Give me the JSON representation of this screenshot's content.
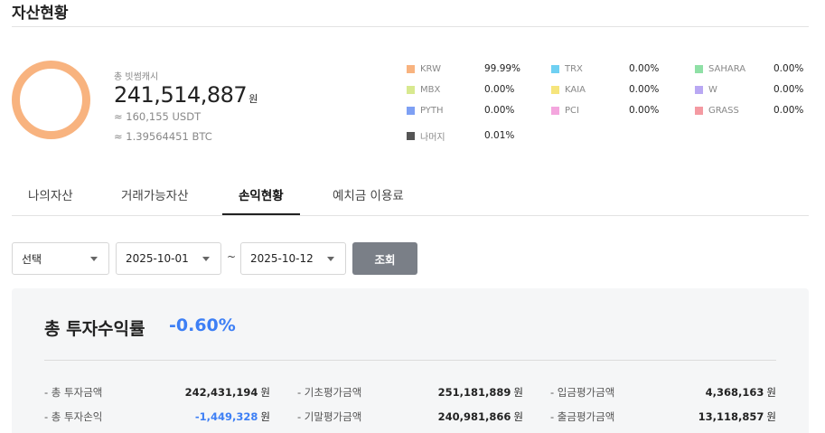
{
  "page": {
    "title": "자산현황"
  },
  "summary": {
    "label": "총 빗썸캐시",
    "total": "241,514,887",
    "total_unit": "원",
    "usdt": "≈ 160,155 USDT",
    "btc": "≈ 1.39564451 BTC"
  },
  "donut": {
    "color": "#f8b37f",
    "share_krw": 99.99
  },
  "legend": [
    {
      "name": "KRW",
      "pct": "99.99%",
      "color": "#f8b37f"
    },
    {
      "name": "TRX",
      "pct": "0.00%",
      "color": "#6fd0f2"
    },
    {
      "name": "SAHARA",
      "pct": "0.00%",
      "color": "#8fe0a6"
    },
    {
      "name": "MBX",
      "pct": "0.00%",
      "color": "#d8e98f"
    },
    {
      "name": "KAIA",
      "pct": "0.00%",
      "color": "#f6e57c"
    },
    {
      "name": "W",
      "pct": "0.00%",
      "color": "#b9a8f3"
    },
    {
      "name": "PYTH",
      "pct": "0.00%",
      "color": "#7ea0f4"
    },
    {
      "name": "PCI",
      "pct": "0.00%",
      "color": "#f4a6de"
    },
    {
      "name": "GRASS",
      "pct": "0.00%",
      "color": "#f49aa2"
    },
    {
      "name": "나머지",
      "pct": "0.01%",
      "color": "#555555"
    }
  ],
  "tabs": [
    {
      "label": "나의자산",
      "active": false
    },
    {
      "label": "거래가능자산",
      "active": false
    },
    {
      "label": "손익현황",
      "active": true
    },
    {
      "label": "예치금 이용료",
      "active": false
    }
  ],
  "filter": {
    "type_select": "선택",
    "start_date": "2025-10-01",
    "separator": "~",
    "end_date": "2025-10-12",
    "search_label": "조회"
  },
  "panel": {
    "title": "총 투자수익률",
    "rate": "-0.60%",
    "unit": "원",
    "metrics": [
      {
        "label": "- 총 투자금액",
        "value": "242,431,194"
      },
      {
        "label": "- 기초평가금액",
        "value": "251,181,889"
      },
      {
        "label": "- 입금평가금액",
        "value": "4,368,163"
      },
      {
        "label": "- 총 투자손익",
        "value": "-1,449,328",
        "negative": true
      },
      {
        "label": "- 기말평가금액",
        "value": "240,981,866"
      },
      {
        "label": "- 출금평가금액",
        "value": "13,118,857"
      }
    ]
  }
}
